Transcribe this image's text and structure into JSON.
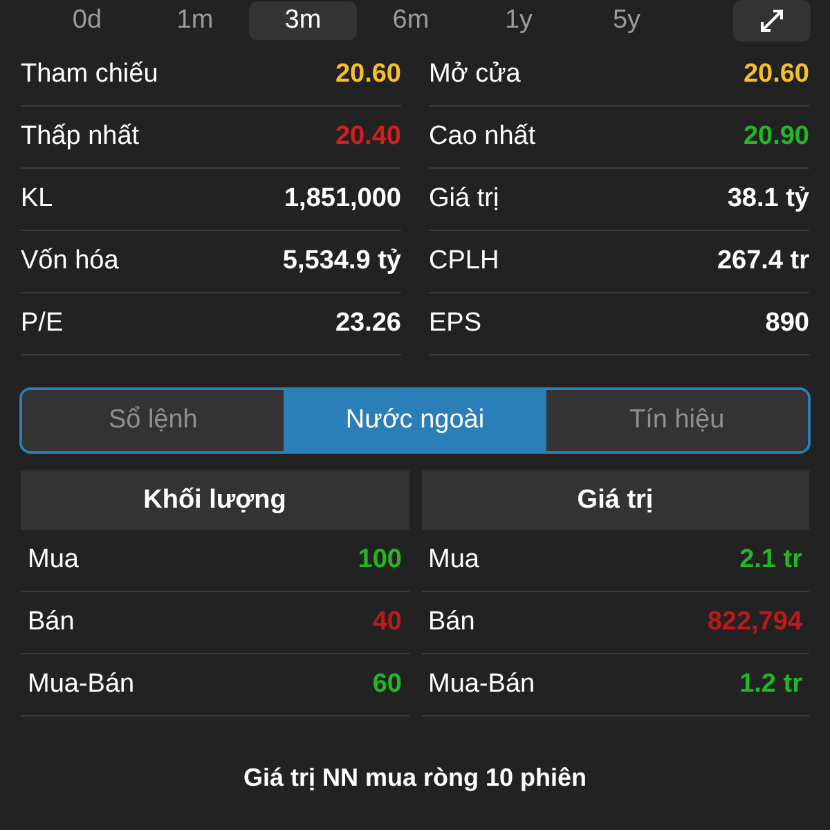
{
  "periods": [
    {
      "label": "0d",
      "selected": false
    },
    {
      "label": "1m",
      "selected": false
    },
    {
      "label": "3m",
      "selected": true
    },
    {
      "label": "6m",
      "selected": false
    },
    {
      "label": "1y",
      "selected": false
    },
    {
      "label": "5y",
      "selected": false
    }
  ],
  "stats": [
    [
      {
        "label": "Tham chiếu",
        "value": "20.60",
        "color": "#f5c02c"
      },
      {
        "label": "Mở cửa",
        "value": "20.60",
        "color": "#f5c02c"
      }
    ],
    [
      {
        "label": "Thấp nhất",
        "value": "20.40",
        "color": "#d11f1f"
      },
      {
        "label": "Cao nhất",
        "value": "20.90",
        "color": "#22b822"
      }
    ],
    [
      {
        "label": "KL",
        "value": "1,851,000",
        "color": "#ffffff"
      },
      {
        "label": "Giá trị",
        "value": "38.1 tỷ",
        "color": "#ffffff"
      }
    ],
    [
      {
        "label": "Vốn hóa",
        "value": "5,534.9 tỷ",
        "color": "#ffffff"
      },
      {
        "label": "CPLH",
        "value": "267.4 tr",
        "color": "#ffffff"
      }
    ],
    [
      {
        "label": "P/E",
        "value": "23.26",
        "color": "#ffffff"
      },
      {
        "label": "EPS",
        "value": "890",
        "color": "#ffffff"
      }
    ]
  ],
  "tabs": [
    {
      "label": "Sổ lệnh",
      "selected": false
    },
    {
      "label": "Nước ngoài",
      "selected": true
    },
    {
      "label": "Tín hiệu",
      "selected": false
    }
  ],
  "tables": [
    {
      "title": "Khối lượng",
      "rows": [
        {
          "label": "Mua",
          "value": "100",
          "color": "#22b822"
        },
        {
          "label": "Bán",
          "value": "40",
          "color": "#c01818"
        },
        {
          "label": "Mua-Bán",
          "value": "60",
          "color": "#22b822"
        }
      ]
    },
    {
      "title": "Giá trị",
      "rows": [
        {
          "label": "Mua",
          "value": "2.1 tr",
          "color": "#22b822"
        },
        {
          "label": "Bán",
          "value": "822,794",
          "color": "#c01818"
        },
        {
          "label": "Mua-Bán",
          "value": "1.2 tr",
          "color": "#22b822"
        }
      ]
    }
  ],
  "footer": "Giá trị NN mua ròng 10 phiên"
}
